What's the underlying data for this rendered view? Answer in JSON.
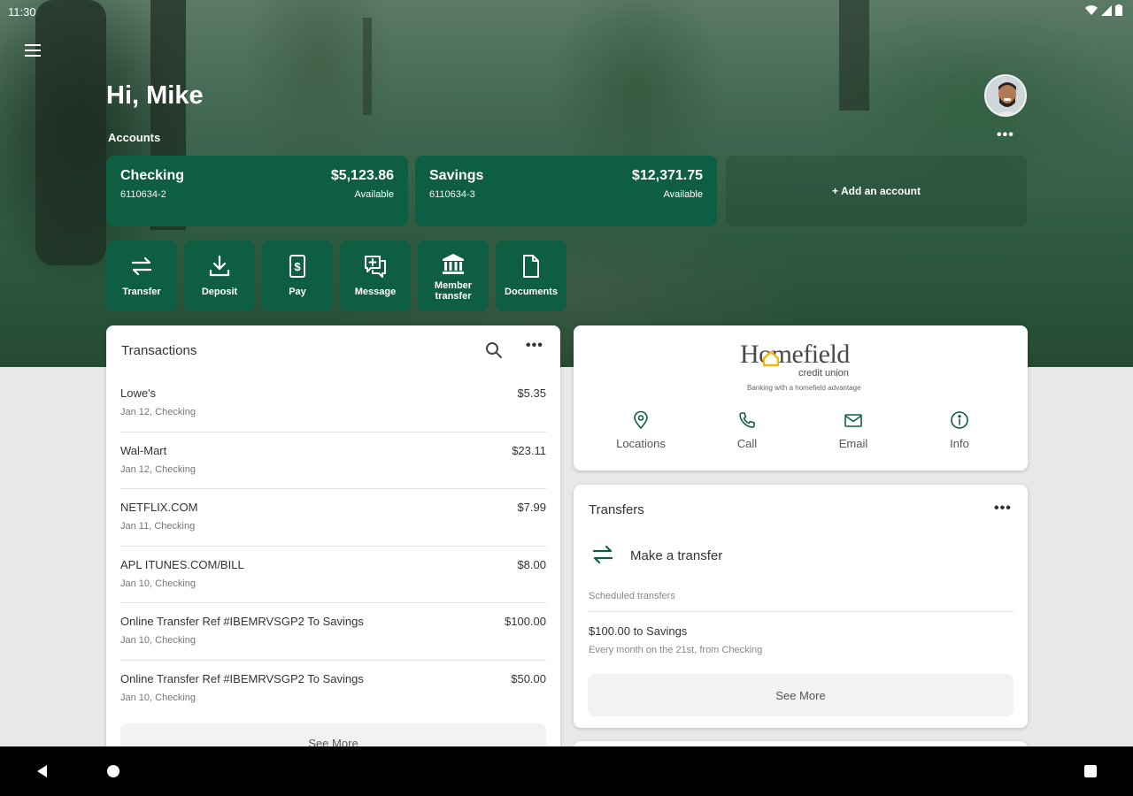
{
  "status_bar": {
    "time": "11:30"
  },
  "header": {
    "greeting": "Hi, Mike",
    "accounts_label": "Accounts",
    "add_account": "+ Add an account"
  },
  "accounts": [
    {
      "name": "Checking",
      "number": "6110634-2",
      "balance": "$5,123.86",
      "balance_label": "Available"
    },
    {
      "name": "Savings",
      "number": "6110634-3",
      "balance": "$12,371.75",
      "balance_label": "Available"
    }
  ],
  "actions": [
    {
      "label": "Transfer",
      "icon": "transfer-icon"
    },
    {
      "label": "Deposit",
      "icon": "deposit-icon"
    },
    {
      "label": "Pay",
      "icon": "pay-icon"
    },
    {
      "label": "Message",
      "icon": "message-icon"
    },
    {
      "label": "Member transfer",
      "icon": "bank-icon"
    },
    {
      "label": "Documents",
      "icon": "document-icon"
    }
  ],
  "transactions": {
    "title": "Transactions",
    "see_more": "See More",
    "items": [
      {
        "description": "Lowe's",
        "meta": "Jan 12, Checking",
        "amount": "$5.35"
      },
      {
        "description": "Wal-Mart",
        "meta": "Jan 12, Checking",
        "amount": "$23.11"
      },
      {
        "description": "NETFLIX.COM",
        "meta": "Jan 11, Checking",
        "amount": "$7.99"
      },
      {
        "description": "APL ITUNES.COM/BILL",
        "meta": "Jan 10, Checking",
        "amount": "$8.00"
      },
      {
        "description": "Online Transfer Ref #IBEMRVSGP2 To Savings",
        "meta": "Jan 10, Checking",
        "amount": "$100.00"
      },
      {
        "description": "Online Transfer Ref #IBEMRVSGP2 To Savings",
        "meta": "Jan 10, Checking",
        "amount": "$50.00"
      }
    ]
  },
  "brand": {
    "logo_word": "Homefield",
    "logo_sub": "credit union",
    "tagline": "Banking with a homefield advantage",
    "quick_links": [
      {
        "label": "Locations",
        "icon": "location-pin-icon"
      },
      {
        "label": "Call",
        "icon": "phone-icon"
      },
      {
        "label": "Email",
        "icon": "email-icon"
      },
      {
        "label": "Info",
        "icon": "info-icon"
      }
    ]
  },
  "transfers": {
    "title": "Transfers",
    "make_transfer": "Make a transfer",
    "scheduled_label": "Scheduled transfers",
    "scheduled": [
      {
        "title": "$100.00 to Savings",
        "detail": "Every month on the 21st, from Checking"
      }
    ],
    "see_more": "See More"
  },
  "colors": {
    "brand_green": "#0e5e44",
    "accent_yellow": "#f2b705"
  }
}
